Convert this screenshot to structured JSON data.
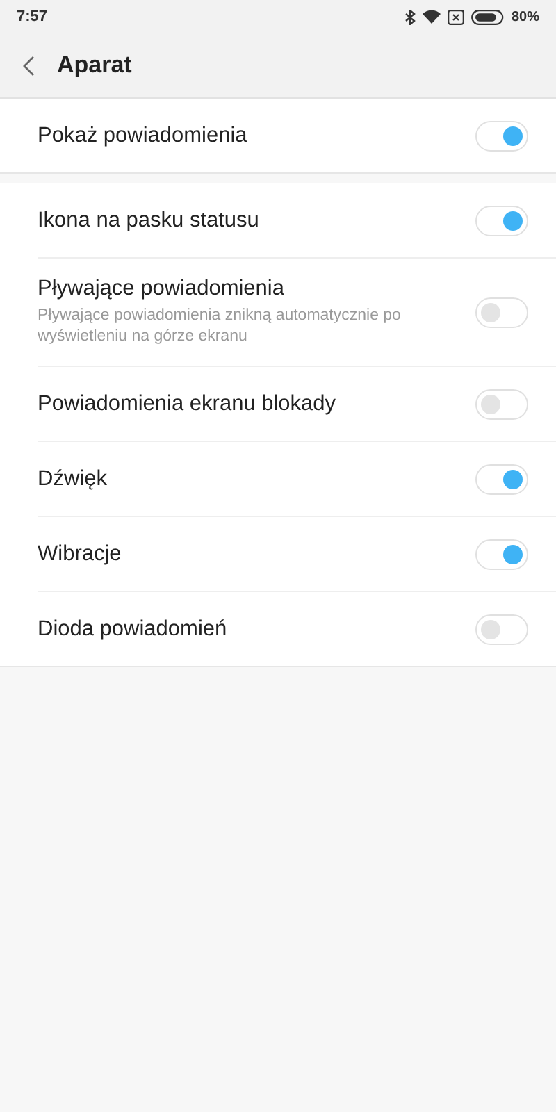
{
  "status_bar": {
    "time": "7:57",
    "battery": "80%"
  },
  "header": {
    "title": "Aparat"
  },
  "sections": [
    {
      "items": [
        {
          "label": "Pokaż powiadomienia",
          "on": true
        }
      ]
    },
    {
      "items": [
        {
          "label": "Ikona na pasku statusu",
          "on": true
        },
        {
          "label": "Pływające powiadomienia",
          "description": "Pływające powiadomienia znikną automatycznie po wyświetleniu na górze ekranu",
          "on": false
        },
        {
          "label": "Powiadomienia ekranu blokady",
          "on": false
        },
        {
          "label": "Dźwięk",
          "on": true
        },
        {
          "label": "Wibracje",
          "on": true
        },
        {
          "label": "Dioda powiadomień",
          "on": false
        }
      ]
    }
  ]
}
